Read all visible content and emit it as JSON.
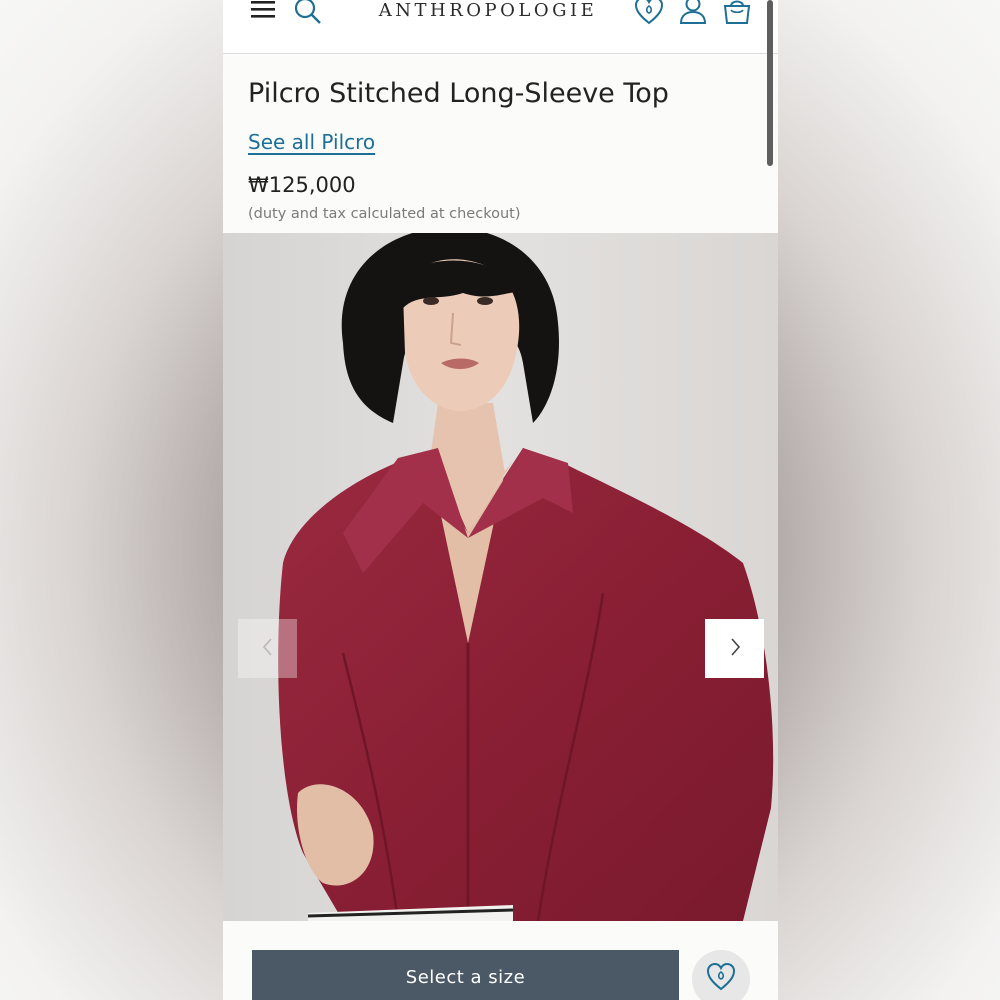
{
  "header": {
    "logo": "ANTHROPOLOGIE",
    "icons": [
      "menu-icon",
      "search-icon",
      "wishlist-heart-icon",
      "account-icon",
      "bag-icon"
    ]
  },
  "product": {
    "title": "Pilcro Stitched Long-Sleeve Top",
    "brand_link": "See all Pilcro",
    "price": "₩125,000",
    "price_note": "(duty and tax calculated at checkout)"
  },
  "gallery": {
    "prev_icon": "chevron-left-icon",
    "next_icon": "chevron-right-icon"
  },
  "actions": {
    "select_size_label": "Select a size",
    "wishlist_icon": "heart-icon"
  },
  "colors": {
    "accent_teal": "#1e6f95",
    "button_slate": "#4b5966",
    "top_burgundy": "#8e2136"
  }
}
